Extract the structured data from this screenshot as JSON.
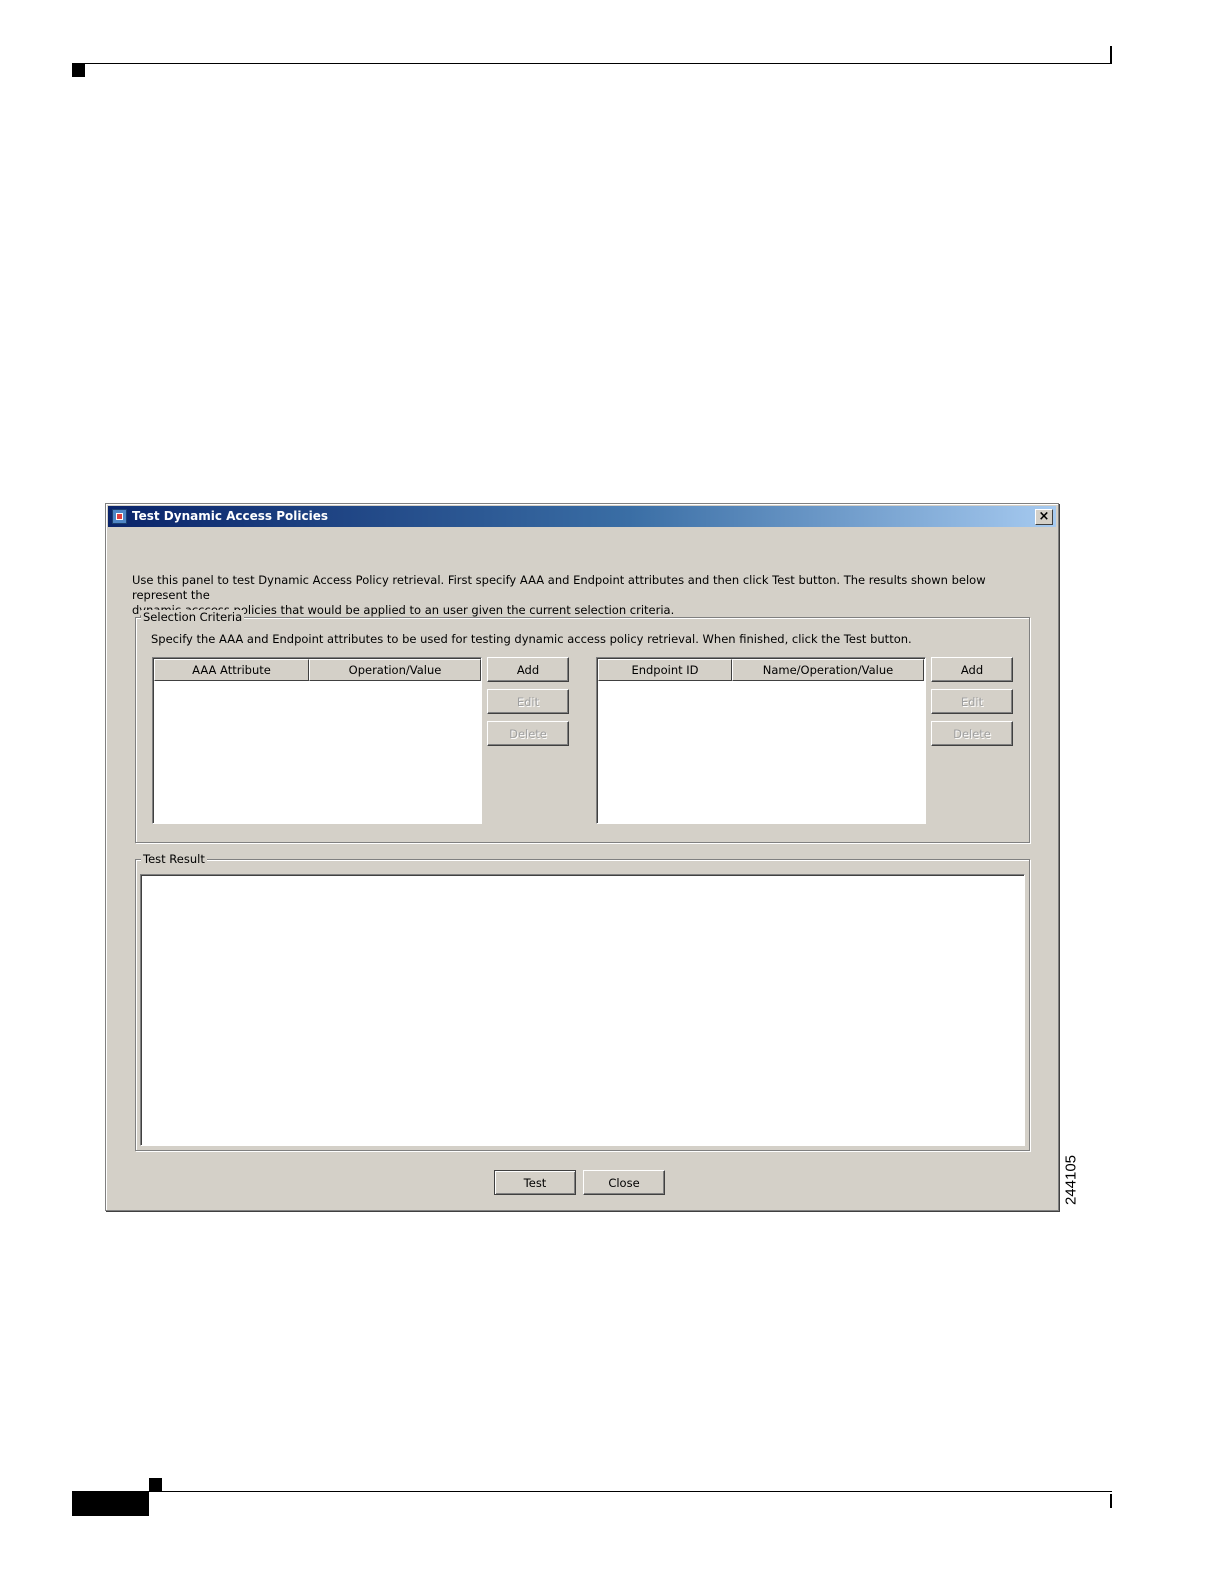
{
  "figure_number": "244105",
  "dialog": {
    "title": "Test Dynamic Access Policies",
    "close_glyph": "×",
    "intro_line1": "Use this panel to test Dynamic Access Policy retrieval. First specify AAA and Endpoint attributes and then click Test button. The results shown below represent the",
    "intro_line2": "dynamic acccess policies that would be applied to an user given the current selection criteria."
  },
  "selection_criteria": {
    "label": "Selection Criteria",
    "description": "Specify the AAA and Endpoint attributes to be used for testing dynamic access policy retrieval. When finished, click the Test button.",
    "aaa_table": {
      "columns": [
        "AAA Attribute",
        "Operation/Value"
      ],
      "rows": []
    },
    "endpoint_table": {
      "columns": [
        "Endpoint ID",
        "Name/Operation/Value"
      ],
      "rows": []
    },
    "aaa_buttons": {
      "add": "Add",
      "edit": "Edit",
      "delete": "Delete"
    },
    "endpoint_buttons": {
      "add": "Add",
      "edit": "Edit",
      "delete": "Delete"
    }
  },
  "test_result": {
    "label": "Test Result",
    "content": ""
  },
  "footer_buttons": {
    "test": "Test",
    "close": "Close"
  }
}
